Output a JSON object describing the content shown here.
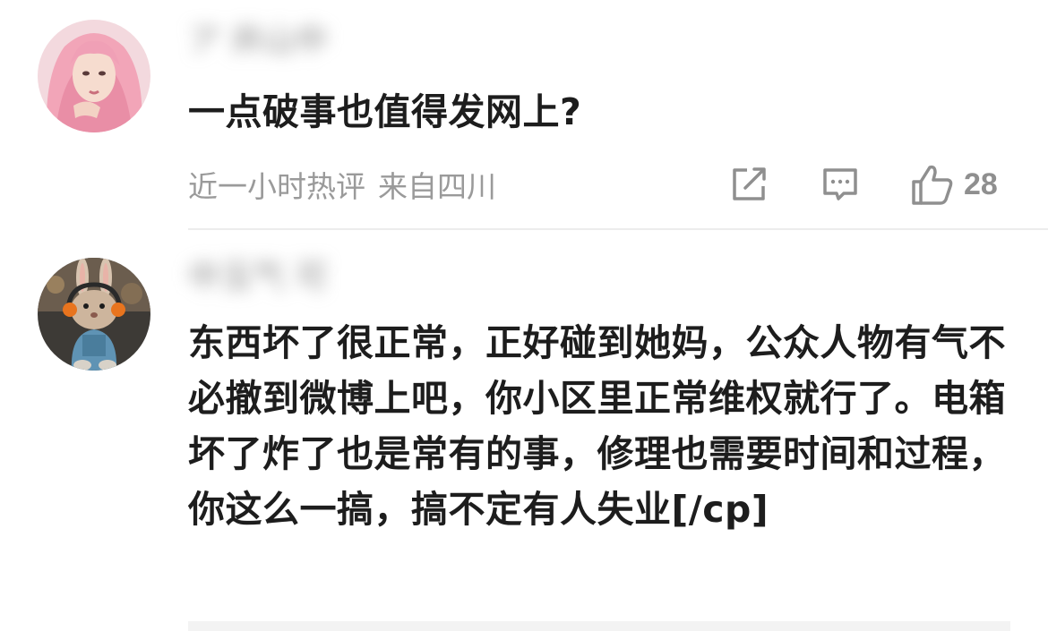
{
  "comments": [
    {
      "username": "ア 井山中",
      "text": "一点破事也值得发网上?",
      "meta_time": "近一小时热评",
      "meta_location": "来自四川",
      "likes": "28",
      "avatar_icon": "pink-hair-girl-avatar"
    },
    {
      "username": "中玉气 可",
      "text": "东西坏了很正常，正好碰到她妈，公众人物有气不必撤到微博上吧，你小区里正常维权就行了。电箱坏了炸了也是常有的事，修理也需要时间和过程，你这么一搞，搞不定有人失业[/cp]",
      "avatar_icon": "rabbit-headphones-avatar"
    }
  ],
  "icons": {
    "repost": "edit-square-icon",
    "comment": "comment-bubble-icon",
    "like": "thumbs-up-icon"
  },
  "colors": {
    "text": "#1d1d1d",
    "meta": "#9a9a9a",
    "icon": "#8f8f8f"
  }
}
